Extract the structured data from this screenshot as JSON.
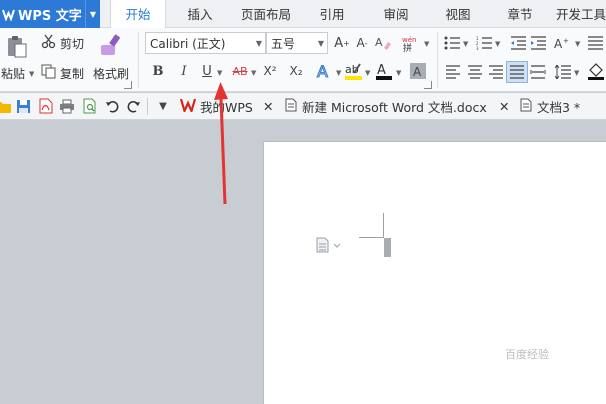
{
  "app": {
    "title": "WPS 文字"
  },
  "menu_tabs": [
    "开始",
    "插入",
    "页面布局",
    "引用",
    "审阅",
    "视图",
    "章节",
    "开发工具"
  ],
  "ribbon": {
    "clipboard": {
      "cut": "剪切",
      "copy": "复制",
      "paste": "粘贴",
      "format_painter": "格式刷"
    },
    "font_name": "Calibri (正文)",
    "font_size": "五号",
    "font_buttons": {
      "bold": "B",
      "italic": "I",
      "underline": "U",
      "strike": "AB",
      "superscript": "X²",
      "subscript": "X₂"
    },
    "phonetic": "拼"
  },
  "doc_tabs": [
    {
      "label": "我的WPS"
    },
    {
      "label": "新建 Microsoft Word 文档.docx"
    },
    {
      "label": "文档3 *"
    }
  ],
  "watermark": "百度经验",
  "colors": {
    "accent": "#2d7ad6",
    "arrow": "#e53333",
    "wps_red": "#d9261c"
  }
}
